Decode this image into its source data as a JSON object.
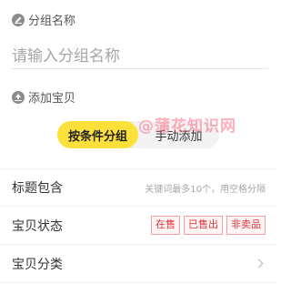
{
  "group_name": {
    "label": "分组名称",
    "placeholder": "请输入分组名称",
    "icon": "edit-icon"
  },
  "add_items": {
    "label": "添加宝贝",
    "icon": "upload-icon"
  },
  "mode_tabs": [
    {
      "label": "按条件分组",
      "active": true
    },
    {
      "label": "手动添加",
      "active": false
    }
  ],
  "watermark": "@蒲花知识网",
  "rows": {
    "title_contains": {
      "label": "标题包含",
      "hint": "关键词最多10个，用空格分隔"
    },
    "status": {
      "label": "宝贝状态",
      "tags": [
        "在售",
        "已售出",
        "非卖品"
      ]
    },
    "category": {
      "label": "宝贝分类"
    }
  },
  "colors": {
    "accent_yellow": "#fde13a",
    "tag_red": "#e0303a",
    "muted_gray": "#a6a6a6"
  }
}
